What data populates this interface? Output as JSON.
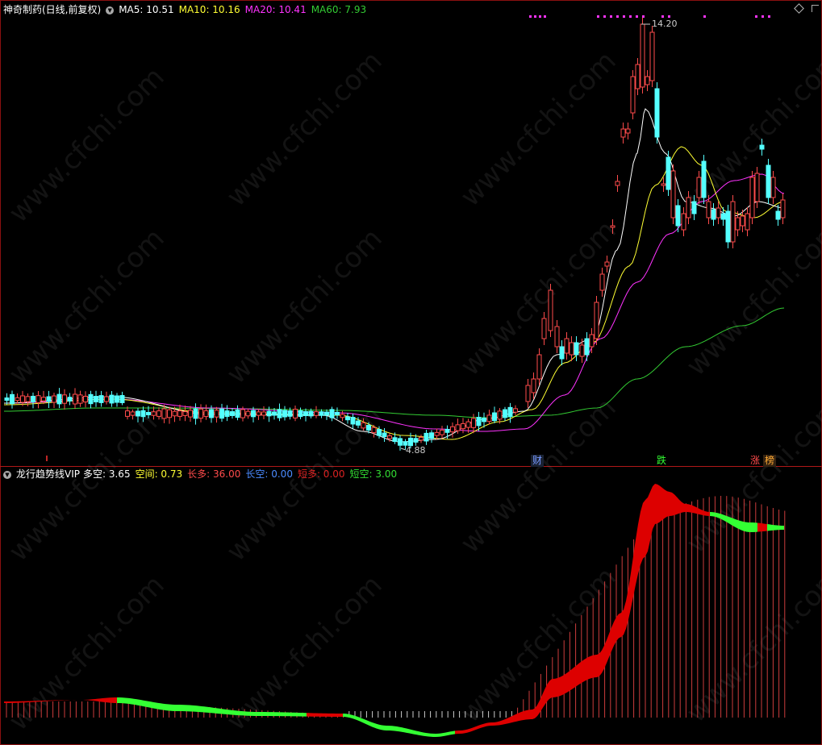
{
  "main_header": {
    "title": "神奇制药(日线,前复权)",
    "ma5": "MA5: 10.51",
    "ma10": "MA10: 10.16",
    "ma20": "MA20: 10.41",
    "ma60": "MA60: 7.93"
  },
  "colors": {
    "ma5": "#ffffff",
    "ma10": "#ffff33",
    "ma20": "#ff33ff",
    "ma60": "#33cc33",
    "up": "#ff4b4b",
    "down": "#54ffff",
    "long_fill": "#dd0000",
    "short_fill": "#33ff33"
  },
  "price_labels": {
    "high": "14.20",
    "low": "4.88"
  },
  "event_markers": [
    {
      "text": "财",
      "color": "#7799ff"
    },
    {
      "text": "跌",
      "color": "#33ff33"
    },
    {
      "text": "涨",
      "color": "#ff4b4b"
    },
    {
      "text": "榜",
      "color": "#ffaa33"
    }
  ],
  "indicator_header": {
    "title": "龙行趋势线VIP",
    "duo_kong": "多空: 3.65",
    "kong_jian": "空间: 0.73",
    "chang_duo": "长多: 36.00",
    "chang_kong": "长空: 0.00",
    "duan_duo": "短多: 0.00",
    "duan_kong": "短空: 3.00"
  },
  "watermark": "www.cfchi.com",
  "chart_data": [
    {
      "type": "candlestick",
      "title": "神奇制药(日线,前复权)",
      "x_range": [
        0,
        120
      ],
      "y_range": [
        4.5,
        14.5
      ],
      "annotations": {
        "high": 14.2,
        "low": 4.88
      },
      "series": [
        {
          "name": "MA5",
          "values": [
            10.51
          ]
        },
        {
          "name": "MA10",
          "values": [
            10.16
          ]
        },
        {
          "name": "MA20",
          "values": [
            10.41
          ]
        },
        {
          "name": "MA60",
          "values": [
            7.93
          ]
        }
      ]
    },
    {
      "type": "area",
      "title": "龙行趋势线VIP",
      "series": [
        {
          "name": "多空",
          "values": [
            3.65
          ]
        },
        {
          "name": "空间",
          "values": [
            0.73
          ]
        },
        {
          "name": "长多",
          "values": [
            36.0
          ]
        },
        {
          "name": "长空",
          "values": [
            0.0
          ]
        },
        {
          "name": "短多",
          "values": [
            0.0
          ]
        },
        {
          "name": "短空",
          "values": [
            3.0
          ]
        }
      ]
    }
  ]
}
